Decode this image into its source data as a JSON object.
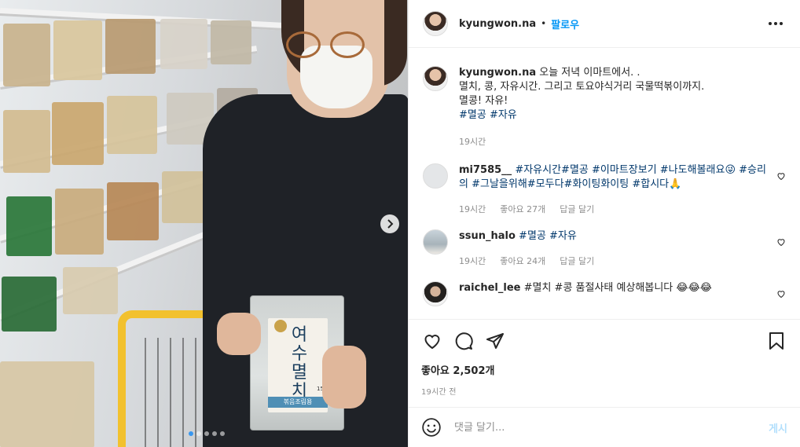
{
  "post": {
    "username": "kyungwon.na",
    "follow_label": "팔로우",
    "caption_text": "오늘 저녁 이마트에서. .",
    "caption_line2": "멸치, 콩, 자유시간. 그리고 토요야식거리 국물떡볶이까지.",
    "caption_line3": "멸콩! 자유!",
    "caption_tags": "#멸공 #자유",
    "caption_time": "19시간"
  },
  "photo": {
    "bag_text": "여수멸치",
    "bag_band": "볶음조림용",
    "bag_weight": "150g",
    "carousel_count": 5,
    "carousel_active": 0
  },
  "comments": [
    {
      "username": "mi7585__",
      "text": "#자유시간#멸공 #이마트장보기 #나도해볼래요😜 #승리의 #그날을위해#모두다#화이팅화이팅 #합시다🙏",
      "time": "19시간",
      "likes": "좋아요 27개",
      "reply": "답글 달기"
    },
    {
      "username": "ssun_halo",
      "text": "#멸공 #자유",
      "time": "19시간",
      "likes": "좋아요 24개",
      "reply": "답글 달기"
    },
    {
      "username": "raichel_lee",
      "text": "#멸치 #콩 품절사태 예상해봅니다 😂😂😂",
      "time": "",
      "likes": "",
      "reply": ""
    }
  ],
  "footer": {
    "likes": "좋아요 2,502개",
    "timestamp": "19시간 전",
    "comment_placeholder": "댓글 달기...",
    "post_label": "게시"
  },
  "icons": {
    "like": "heart-icon",
    "comment": "comment-icon",
    "share": "share-icon",
    "save": "bookmark-icon",
    "more": "more-icon",
    "emoji": "emoji-icon",
    "next": "chevron-right-icon"
  },
  "colors": {
    "link": "#0095f6",
    "tag": "#00376b",
    "muted": "#8e8e8e",
    "carousel_active": "#3897f0"
  }
}
